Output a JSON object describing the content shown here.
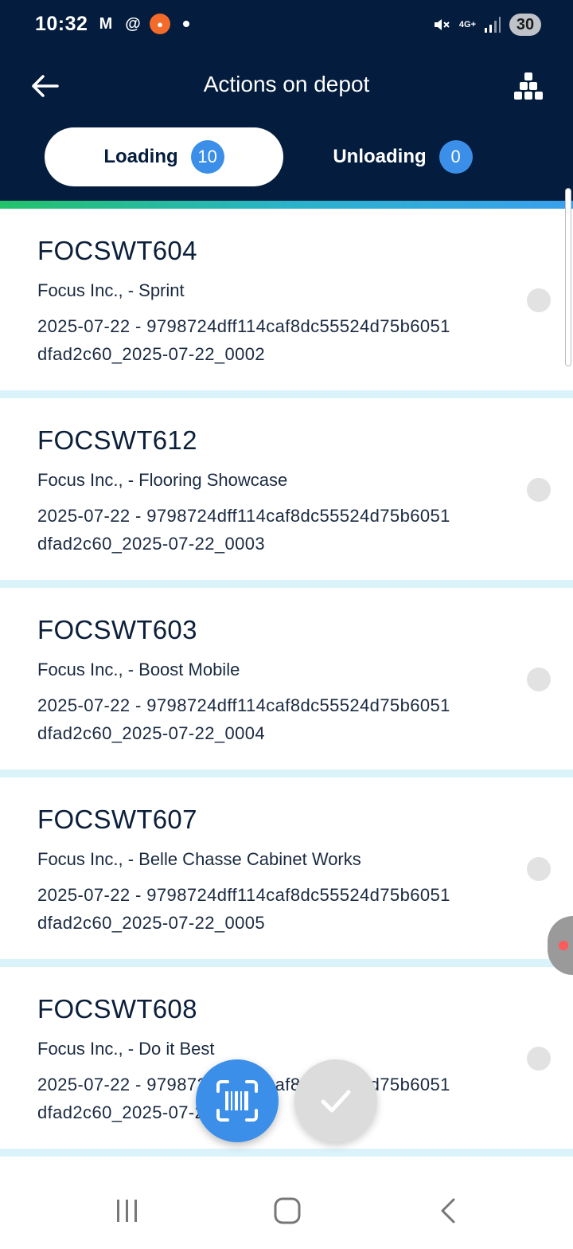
{
  "status_bar": {
    "time": "10:32",
    "app_icons": [
      "gmail-icon",
      "at-sign-icon",
      "record-icon"
    ],
    "network": "4G+",
    "battery": "30"
  },
  "header": {
    "title": "Actions on depot",
    "back_icon": "arrow-left-icon",
    "menu_icon": "boxes-stack-icon"
  },
  "tabs": [
    {
      "label": "Loading",
      "count": "10",
      "active": true
    },
    {
      "label": "Unloading",
      "count": "0",
      "active": false
    }
  ],
  "items": [
    {
      "code": "FOCSWT604",
      "company": "Focus Inc., - Sprint",
      "line1": "2025-07-22 - 9798724dff114caf8dc55524d75b6051",
      "line2": "dfad2c60_2025-07-22_0002"
    },
    {
      "code": "FOCSWT612",
      "company": "Focus Inc., - Flooring Showcase",
      "line1": "2025-07-22 - 9798724dff114caf8dc55524d75b6051",
      "line2": "dfad2c60_2025-07-22_0003"
    },
    {
      "code": "FOCSWT603",
      "company": "Focus Inc., - Boost Mobile",
      "line1": "2025-07-22 - 9798724dff114caf8dc55524d75b6051",
      "line2": "dfad2c60_2025-07-22_0004"
    },
    {
      "code": "FOCSWT607",
      "company": "Focus Inc., - Belle Chasse Cabinet Works",
      "line1": "2025-07-22 - 9798724dff114caf8dc55524d75b6051",
      "line2": "dfad2c60_2025-07-22_0005"
    },
    {
      "code": "FOCSWT608",
      "company": "Focus Inc., - Do it Best",
      "line1": "2025-07-22 - 9798724dff114caf8dc55524d75b6051",
      "line2": "dfad2c60_2025-07-22_0006"
    }
  ],
  "fabs": {
    "scan_icon": "barcode-scan-icon",
    "confirm_icon": "check-icon"
  },
  "colors": {
    "header": "#041c3d",
    "accent": "#3b8fe8",
    "separator": "#daf3fa"
  }
}
